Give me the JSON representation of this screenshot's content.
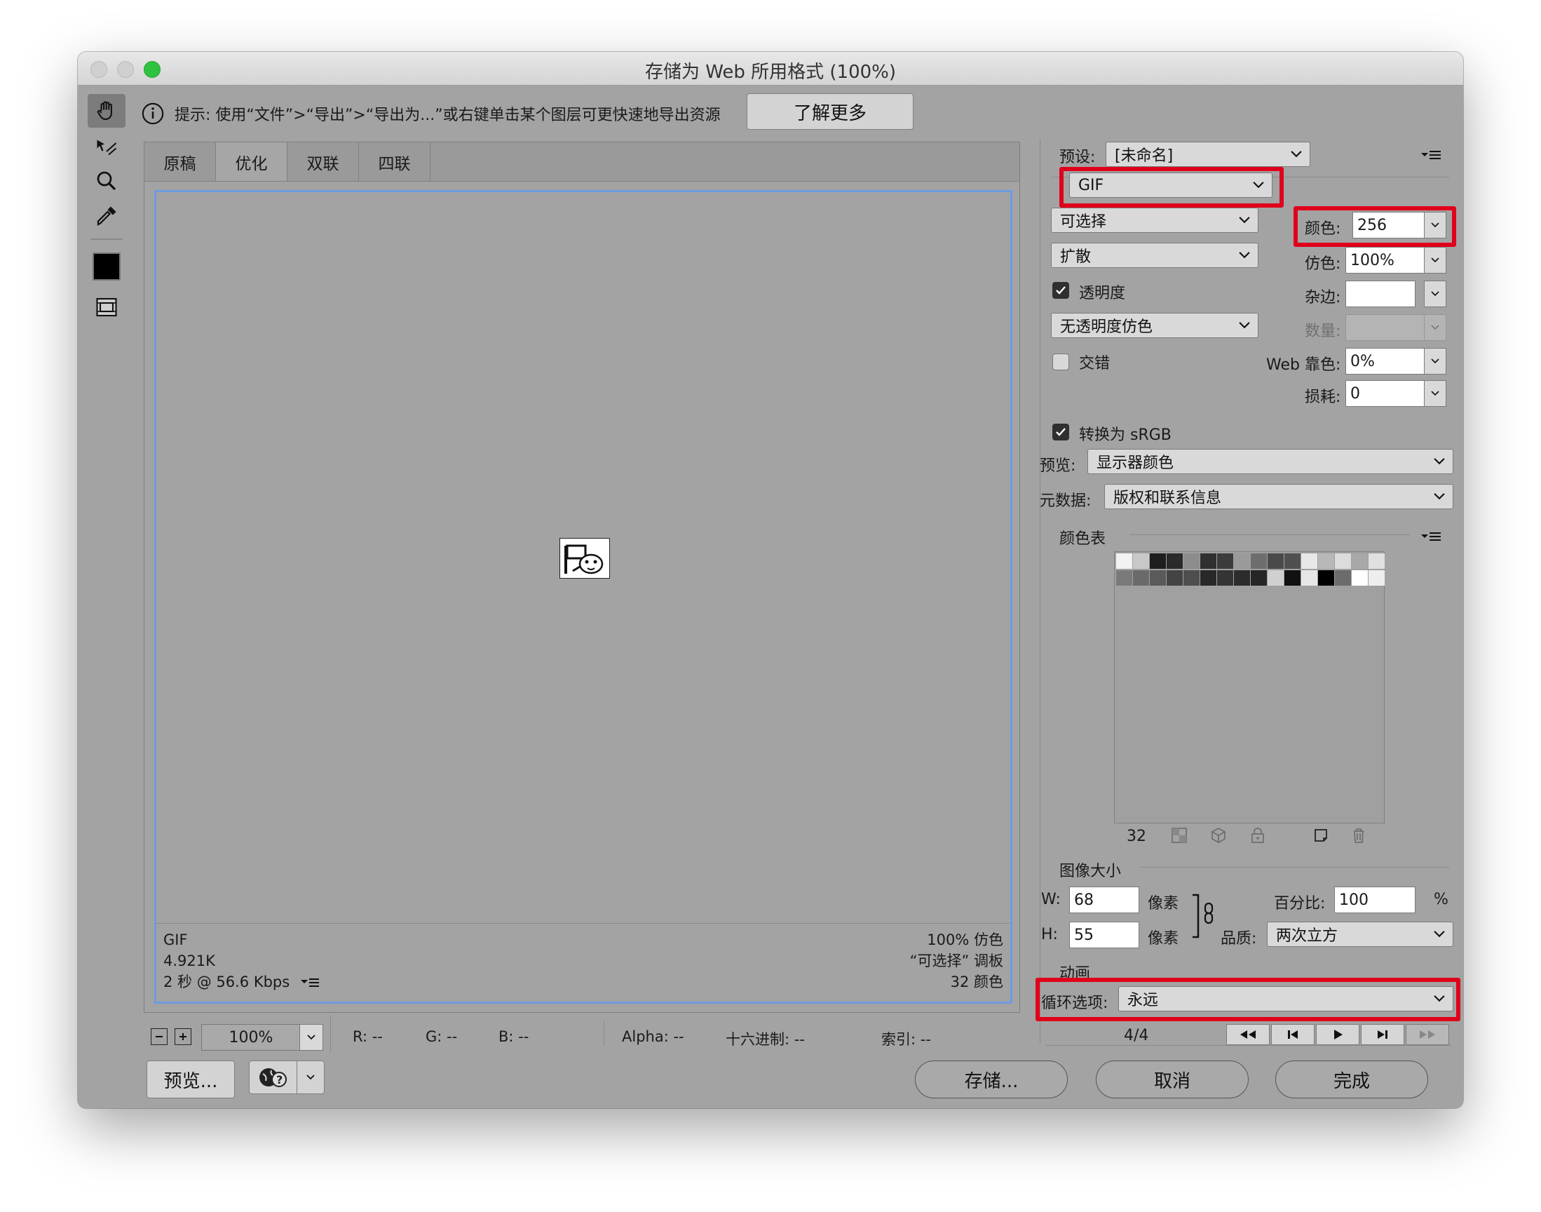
{
  "window": {
    "title": "存储为 Web 所用格式 (100%)"
  },
  "hint": {
    "text": "提示: 使用“文件”>“导出”>“导出为...”或右键单击某个图层可更快速地导出资源",
    "learn_more": "了解更多"
  },
  "tabs": [
    "原稿",
    "优化",
    "双联",
    "四联"
  ],
  "active_tab": 1,
  "image_info": {
    "format": "GIF",
    "size": "4.921K",
    "speed": "2 秒 @ 56.6 Kbps",
    "dither": "100% 仿色",
    "palette": "“可选择” 调板",
    "colors": "32 颜色"
  },
  "statusbar": {
    "zoom": "100%",
    "r": "R: --",
    "g": "G: --",
    "b": "B: --",
    "alpha": "Alpha: --",
    "hex": "十六进制: --",
    "index": "索引: --"
  },
  "settings": {
    "preset_label": "预设:",
    "preset_value": "[未命名]",
    "format_value": "GIF",
    "reduction_value": "可选择",
    "dither_algo_value": "扩散",
    "transparency_label": "透明度",
    "transparency_checked": true,
    "transparency_dither_value": "无透明度仿色",
    "interlaced_label": "交错",
    "interlaced_checked": false,
    "colors_label": "颜色:",
    "colors_value": "256",
    "dither_label": "仿色:",
    "dither_value": "100%",
    "matte_label": "杂边:",
    "amount_label": "数量:",
    "web_snap_label": "Web 靠色:",
    "web_snap_value": "0%",
    "lossy_label": "损耗:",
    "lossy_value": "0",
    "convert_srgb_label": "转换为 sRGB",
    "convert_srgb_checked": true,
    "preview_label": "预览:",
    "preview_value": "显示器颜色",
    "metadata_label": "元数据:",
    "metadata_value": "版权和联系信息"
  },
  "color_table": {
    "title": "颜色表",
    "count": "32",
    "colors": [
      "#f2f2f2",
      "#c8c8c8",
      "#1e1e1e",
      "#2a2a2a",
      "#8c8c8c",
      "#303030",
      "#3c3c3c",
      "#9a9a9a",
      "#6e6e6e",
      "#4a4a4a",
      "#505050",
      "#e8e8e8",
      "#b8b8b8",
      "#dcdcdc",
      "#a8a8a8",
      "#e0e0e0",
      "#7a7a7a",
      "#6a6a6a",
      "#5a5a5a",
      "#444444",
      "#4e4e4e",
      "#282828",
      "#343434",
      "#2c2c2c",
      "#262626",
      "#d0d0d0",
      "#111111",
      "#e6e6e6",
      "#000000",
      "#6c6c6c",
      "#ffffff",
      "#eeeeee"
    ]
  },
  "image_size": {
    "title": "图像大小",
    "w_label": "W:",
    "w_value": "68",
    "h_label": "H:",
    "h_value": "55",
    "unit": "像素",
    "percent_label": "百分比:",
    "percent_value": "100",
    "percent_sign": "%",
    "quality_label": "品质:",
    "quality_value": "两次立方"
  },
  "animation": {
    "title": "动画",
    "loop_label": "循环选项:",
    "loop_value": "永远",
    "frame": "4/4"
  },
  "buttons": {
    "preview": "预览...",
    "save": "存储...",
    "cancel": "取消",
    "done": "完成"
  }
}
